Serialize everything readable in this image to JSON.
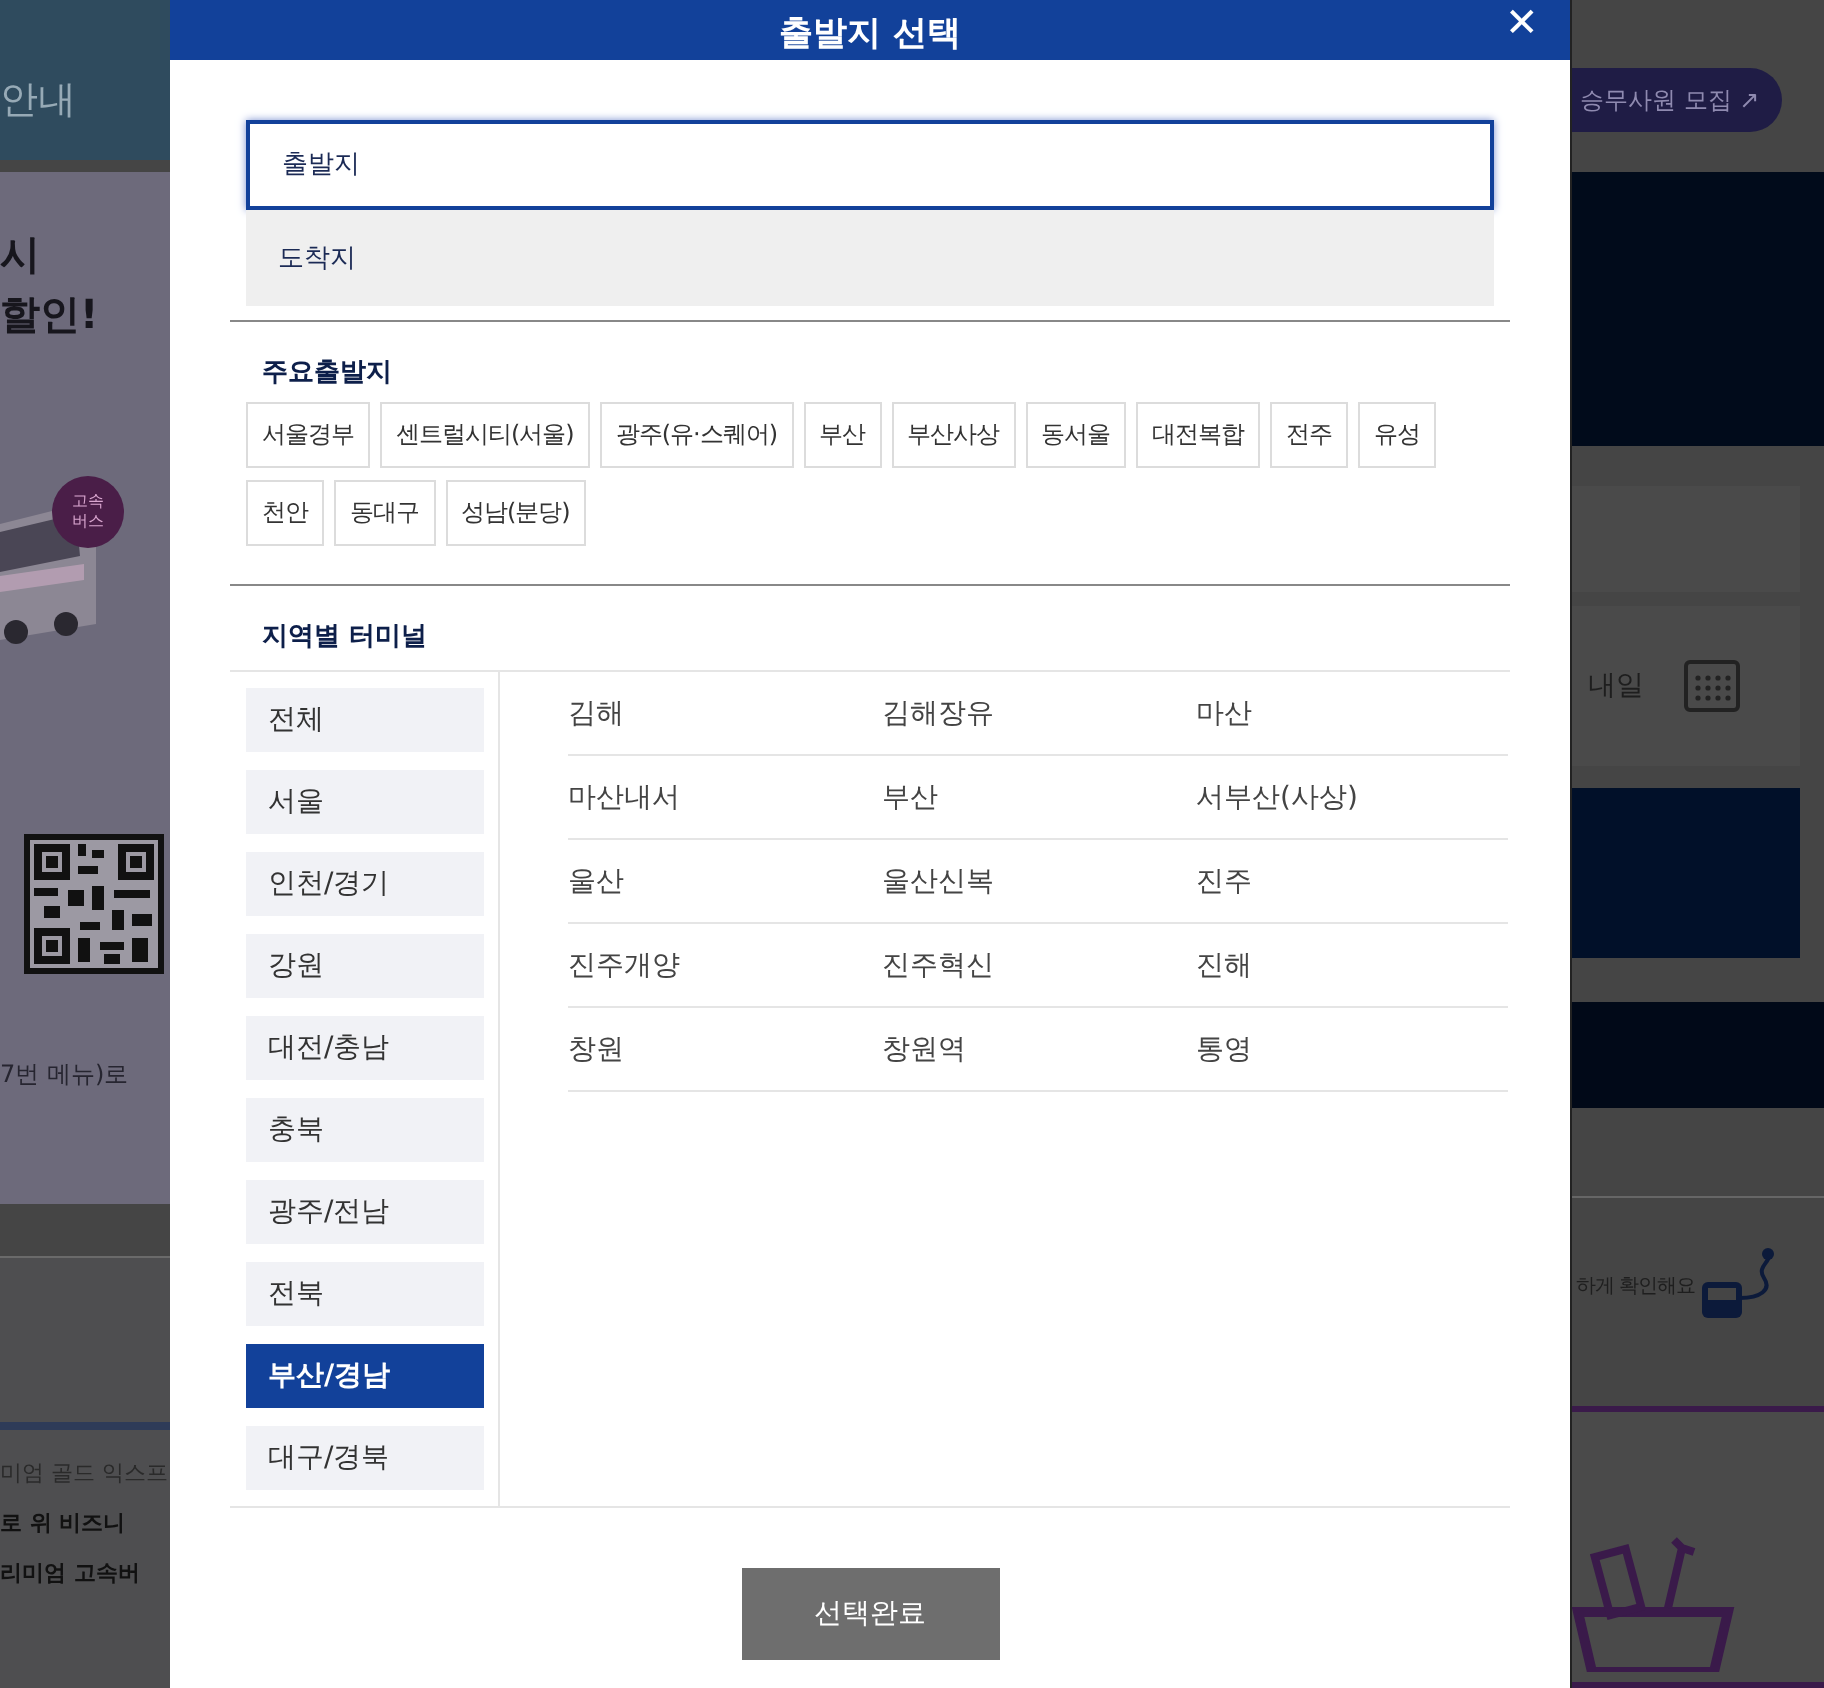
{
  "background_page": {
    "left": {
      "header_text": "안내",
      "promo_lines": [
        "시",
        "할인!"
      ],
      "badge": "고속\n버스",
      "menu_note": "7번 메뉴)로",
      "lower_lines": [
        "미엄 골드 익스프",
        "로 위 비즈니",
        "리미엄 고속버"
      ]
    },
    "right": {
      "recruit_button": "승무사원 모집 ↗",
      "date_value": "내일",
      "tracking_note": "하게 확인해요"
    }
  },
  "dialog": {
    "title": "출발지 선택",
    "close": "✕",
    "fields": [
      {
        "placeholder": "출발지",
        "selected": true
      },
      {
        "placeholder": "도착지",
        "selected": false
      }
    ],
    "main_departures": {
      "heading": "주요출발지",
      "items": [
        "서울경부",
        "센트럴시티(서울)",
        "광주(유·스퀘어)",
        "부산",
        "부산사상",
        "동서울",
        "대전복합",
        "전주",
        "유성",
        "천안",
        "동대구",
        "성남(분당)"
      ]
    },
    "regional_terminals": {
      "heading": "지역별 터미널",
      "regions": [
        {
          "label": "전체",
          "selected": false
        },
        {
          "label": "서울",
          "selected": false
        },
        {
          "label": "인천/경기",
          "selected": false
        },
        {
          "label": "강원",
          "selected": false
        },
        {
          "label": "대전/충남",
          "selected": false
        },
        {
          "label": "충북",
          "selected": false
        },
        {
          "label": "광주/전남",
          "selected": false
        },
        {
          "label": "전북",
          "selected": false
        },
        {
          "label": "부산/경남",
          "selected": true
        },
        {
          "label": "대구/경북",
          "selected": false
        }
      ],
      "terminals": [
        "김해",
        "김해장유",
        "마산",
        "마산내서",
        "부산",
        "서부산(사상)",
        "울산",
        "울산신복",
        "진주",
        "진주개양",
        "진주혁신",
        "진해",
        "창원",
        "창원역",
        "통영"
      ]
    },
    "confirm_button": "선택완료"
  }
}
